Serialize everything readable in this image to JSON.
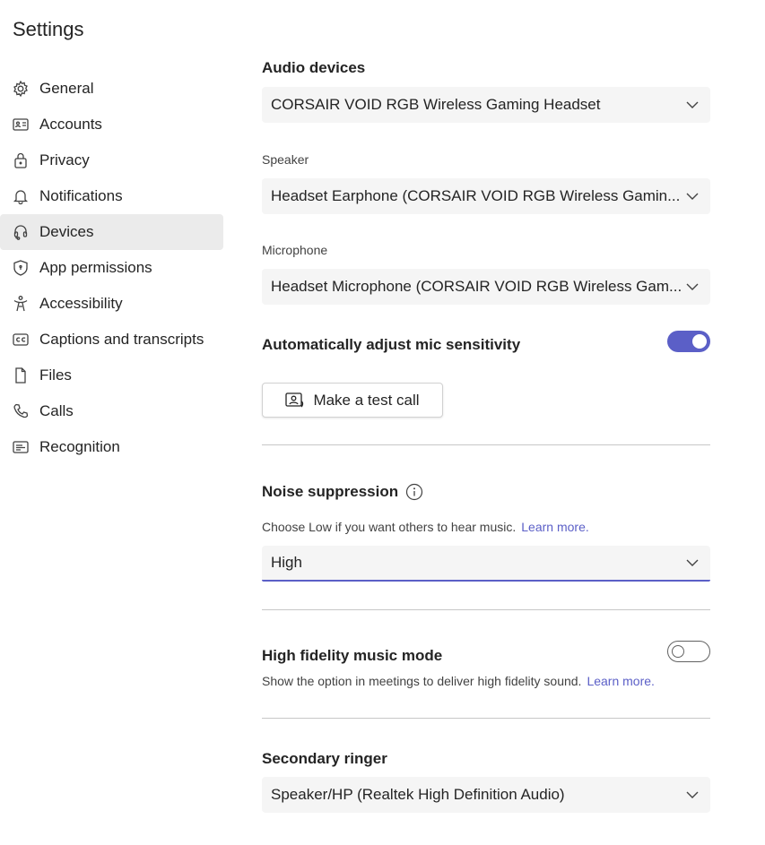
{
  "title": "Settings",
  "sidebar": {
    "items": [
      {
        "label": "General",
        "icon": "gear-icon"
      },
      {
        "label": "Accounts",
        "icon": "id-card-icon"
      },
      {
        "label": "Privacy",
        "icon": "lock-icon"
      },
      {
        "label": "Notifications",
        "icon": "bell-icon"
      },
      {
        "label": "Devices",
        "icon": "headset-icon",
        "selected": true
      },
      {
        "label": "App permissions",
        "icon": "shield-icon"
      },
      {
        "label": "Accessibility",
        "icon": "accessibility-icon"
      },
      {
        "label": "Captions and transcripts",
        "icon": "closed-captions-icon"
      },
      {
        "label": "Files",
        "icon": "file-icon"
      },
      {
        "label": "Calls",
        "icon": "phone-icon"
      },
      {
        "label": "Recognition",
        "icon": "recognition-icon"
      }
    ]
  },
  "main": {
    "audio_devices": {
      "heading": "Audio devices",
      "value": "CORSAIR VOID RGB Wireless Gaming Headset"
    },
    "speaker": {
      "label": "Speaker",
      "value": "Headset Earphone (CORSAIR VOID RGB Wireless Gamin..."
    },
    "microphone": {
      "label": "Microphone",
      "value": "Headset Microphone (CORSAIR VOID RGB Wireless Gam..."
    },
    "auto_mic": {
      "label": "Automatically adjust mic sensitivity",
      "on": true
    },
    "test_call": {
      "label": "Make a test call"
    },
    "noise": {
      "heading": "Noise suppression",
      "desc": "Choose Low if you want others to hear music.",
      "link": "Learn more.",
      "value": "High"
    },
    "hifi": {
      "heading": "High fidelity music mode",
      "on": false,
      "desc": "Show the option in meetings to deliver high fidelity sound.",
      "link": "Learn more."
    },
    "ringer": {
      "heading": "Secondary ringer",
      "value": "Speaker/HP (Realtek High Definition Audio)"
    }
  },
  "colors": {
    "accent": "#5b5fc7",
    "selected_bg": "#ebebeb",
    "dropdown_bg": "#f5f5f5"
  }
}
